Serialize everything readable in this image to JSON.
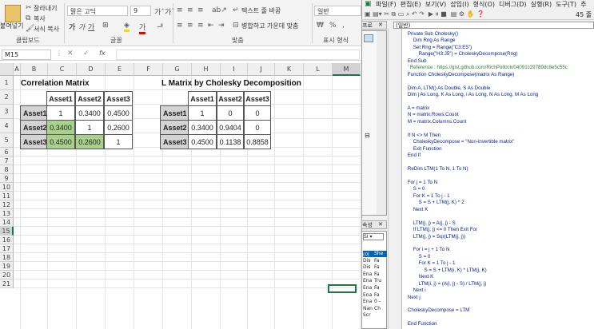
{
  "ribbon": {
    "paste_label": "붙여넣기",
    "cut_label": "잘라내기",
    "copy_label": "복사",
    "format_painter_label": "서식 복사",
    "clipboard_group": "클립보드",
    "font_name": "맑은 고딕",
    "font_size": "9",
    "font_group": "글꼴",
    "wrap_text_label": "텍스트 줄 바꿈",
    "merge_center_label": "병합하고 가운데 맞춤",
    "align_group": "맞춤",
    "number_format": "일반",
    "number_group": "표시 형식",
    "percent_symbol": "%",
    "comma_symbol": ","
  },
  "formula_bar": {
    "name_box": "M15",
    "fx": "fx"
  },
  "columns": [
    "A",
    "B",
    "C",
    "D",
    "E",
    "F",
    "G",
    "H",
    "I",
    "J",
    "K",
    "L",
    "M"
  ],
  "rows": [
    "1",
    "2",
    "3",
    "4",
    "5",
    "6",
    "7",
    "8",
    "9",
    "10",
    "11",
    "12",
    "13",
    "14",
    "15",
    "16",
    "17",
    "18",
    "19",
    "20",
    "21"
  ],
  "correlation": {
    "title": "Correlation Matrix",
    "headers": [
      "Asset1",
      "Asset2",
      "Asset3"
    ],
    "row_labels": [
      "Asset1",
      "Asset2",
      "Asset3"
    ],
    "values": [
      [
        "1",
        "0.3400",
        "0.4500"
      ],
      [
        "0.3400",
        "1",
        "0.2600"
      ],
      [
        "0.4500",
        "0.2600",
        "1"
      ]
    ]
  },
  "cholesky": {
    "title": "L Matrix by Cholesky Decomposition",
    "headers": [
      "Asset1",
      "Asset2",
      "Asset3"
    ],
    "row_labels": [
      "Asset1",
      "Asset2",
      "Asset3"
    ],
    "values": [
      [
        "1",
        "0",
        "0"
      ],
      [
        "0.3400",
        "0.9404",
        "0"
      ],
      [
        "0.4500",
        "0.1138",
        "0.8858"
      ]
    ]
  },
  "vba": {
    "menu": "파일(F)  편집(E)  보기(V)  삽입(I)  형식(O)  디버그(D)  실행(R)  도구(T)  추",
    "zoom": "45 줄",
    "object_combo": "(일반)",
    "project_label": "프로",
    "props_label": "속성",
    "props_items": [
      "(이",
      "Dis",
      "Dis",
      "Ena",
      "Ena",
      "Ena",
      "Ena",
      "Ena",
      "Nan",
      "Scr"
    ],
    "props_values": [
      "She",
      "Fa",
      "Fa",
      "Fa",
      "Tru",
      "Fa",
      "Fa",
      "0 -",
      "Ch",
      ""
    ],
    "code_lines": [
      "    Private Sub Cholesky()",
      "        Dim Rng As Range",
      "        Set Rng = Range(\"C3:E5\")",
      "            Range(\"H3:J5\") = CholeskyDecompose(Rng)",
      "    End Sub",
      "    ' Reference : https://gist.github.com/RichPollock/04091c29789dc8e5c55c",
      "    Function CholeskyDecompose(matrix As Range)",
      "",
      "    Dim A, LTM() As Double, S As Double",
      "    Dim j As Long, K As Long, i As Long, N As Long, M As Long",
      "",
      "    A = matrix",
      "    N = matrix.Rows.Count",
      "    M = matrix.Columns.Count",
      "",
      "    If N <> M Then",
      "        CholeskyDecompose = \"Non-invertible matrix\"",
      "        Exit Function",
      "    End If",
      "",
      "    ReDim LTM(1 To N, 1 To N)",
      "",
      "    For j = 1 To N",
      "        S = 0",
      "        For K = 1 To j - 1",
      "            S = S + LTM(j, K) ^ 2",
      "        Next K",
      "",
      "        LTM(j, j) = A(j, j) - S",
      "        If LTM(j, j) <= 0 Then Exit For",
      "        LTM(j, j) = Sqr(LTM(j, j))",
      "",
      "        For i = j + 1 To N",
      "            S = 0",
      "            For K = 1 To j - 1",
      "                S = S + LTM(i, K) * LTM(j, K)",
      "            Next K",
      "            LTM(i, j) = (A(i, j) - S) / LTM(j, j)",
      "        Next i",
      "    Next j",
      "",
      "    CholeskyDecompose = LTM",
      "",
      "    End Function"
    ]
  }
}
